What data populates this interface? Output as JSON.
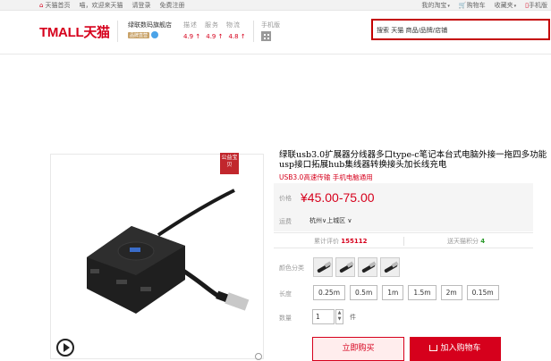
{
  "topnav": {
    "home": "天猫首页",
    "greeting": "喵，欢迎来天猫",
    "login": "请登录",
    "register": "免费注册",
    "my_taobao": "我的淘宝",
    "cart": "购物车",
    "favorites": "收藏夹",
    "mobile": "手机版"
  },
  "header": {
    "logo": "TMALL天猫",
    "store_name": "绿联数码旗舰店",
    "store_badge": "品牌直营",
    "ratings_labels": [
      "描述",
      "服务",
      "物流"
    ],
    "ratings_scores": [
      "4.9 ↑",
      "4.9 ↑",
      "4.8 ↑"
    ],
    "mobile_label": "手机版",
    "search_placeholder": "搜索 天猫 商品/品牌/店铺"
  },
  "gallery": {
    "public_tag": "公益宝贝"
  },
  "product": {
    "title": "绿联usb3.0扩展器分线器多口type-c笔记本台式电脑外接一拖四多功能usp接口拓展hub集线器转换接头加长线充电",
    "subtitle": "USB3.0高速传输 手机电脑通用",
    "price_label": "价格",
    "price": "¥45.00-75.00",
    "shipping_label": "运费",
    "shipping_value": "杭州∨上城区 ∨",
    "reviews_label": "累计评价",
    "reviews_count": "155112",
    "points_label": "送天猫积分",
    "points_value": "4",
    "color_label": "颜色分类",
    "length_label": "长度",
    "lengths": [
      "0.25m",
      "0.5m",
      "1m",
      "1.5m",
      "2m",
      "0.15m"
    ],
    "qty_label": "数量",
    "qty_value": "1",
    "qty_unit": "件",
    "buy_now": "立即购买",
    "add_to_cart": "加入购物车"
  },
  "colors": {
    "accent": "#d6001c"
  }
}
